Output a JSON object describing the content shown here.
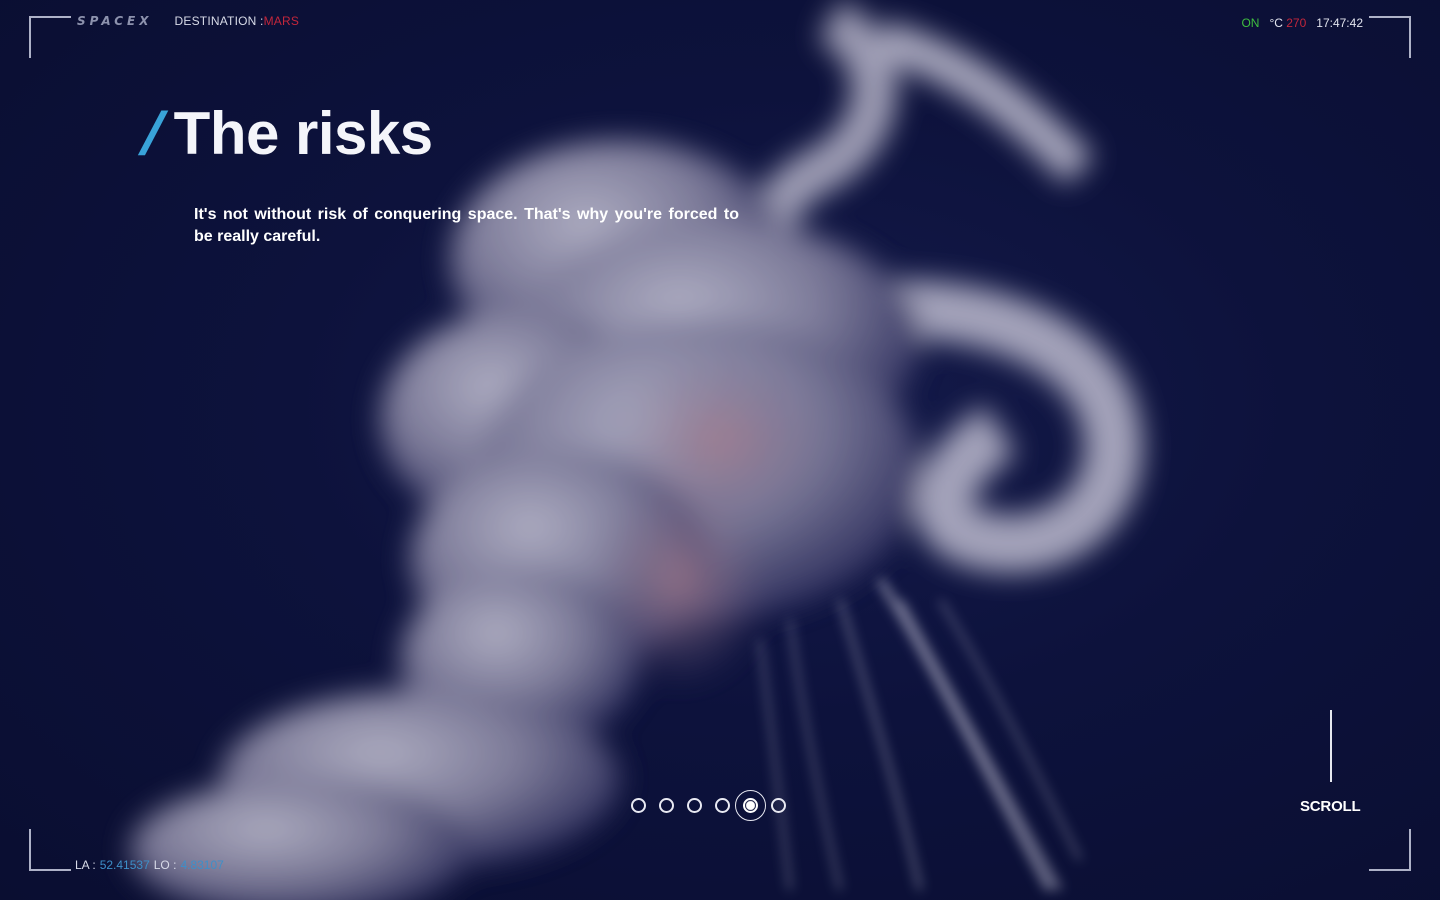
{
  "header": {
    "logo_text": "SPACEX",
    "destination_label": "DESTINATION :",
    "destination_value": "MARS",
    "status": "ON",
    "temperature_unit": "°C",
    "temperature_value": "270",
    "clock": "17:47:42"
  },
  "section": {
    "slash": "/",
    "title": "The risks",
    "intro": "It's not without risk of conquering space. That's why you're forced to be really careful."
  },
  "pager": {
    "count": 6,
    "active_index": 4
  },
  "scroll": {
    "label": "SCROLL"
  },
  "footer": {
    "latitude_label": "LA :",
    "latitude_value": "52.41537",
    "longitude_label": "LO :",
    "longitude_value": "4.83107"
  },
  "colors": {
    "background": "#0b0f33",
    "accent_blue": "#39a3d9",
    "alert_red": "#c3263b",
    "status_green": "#3fbf3f"
  }
}
